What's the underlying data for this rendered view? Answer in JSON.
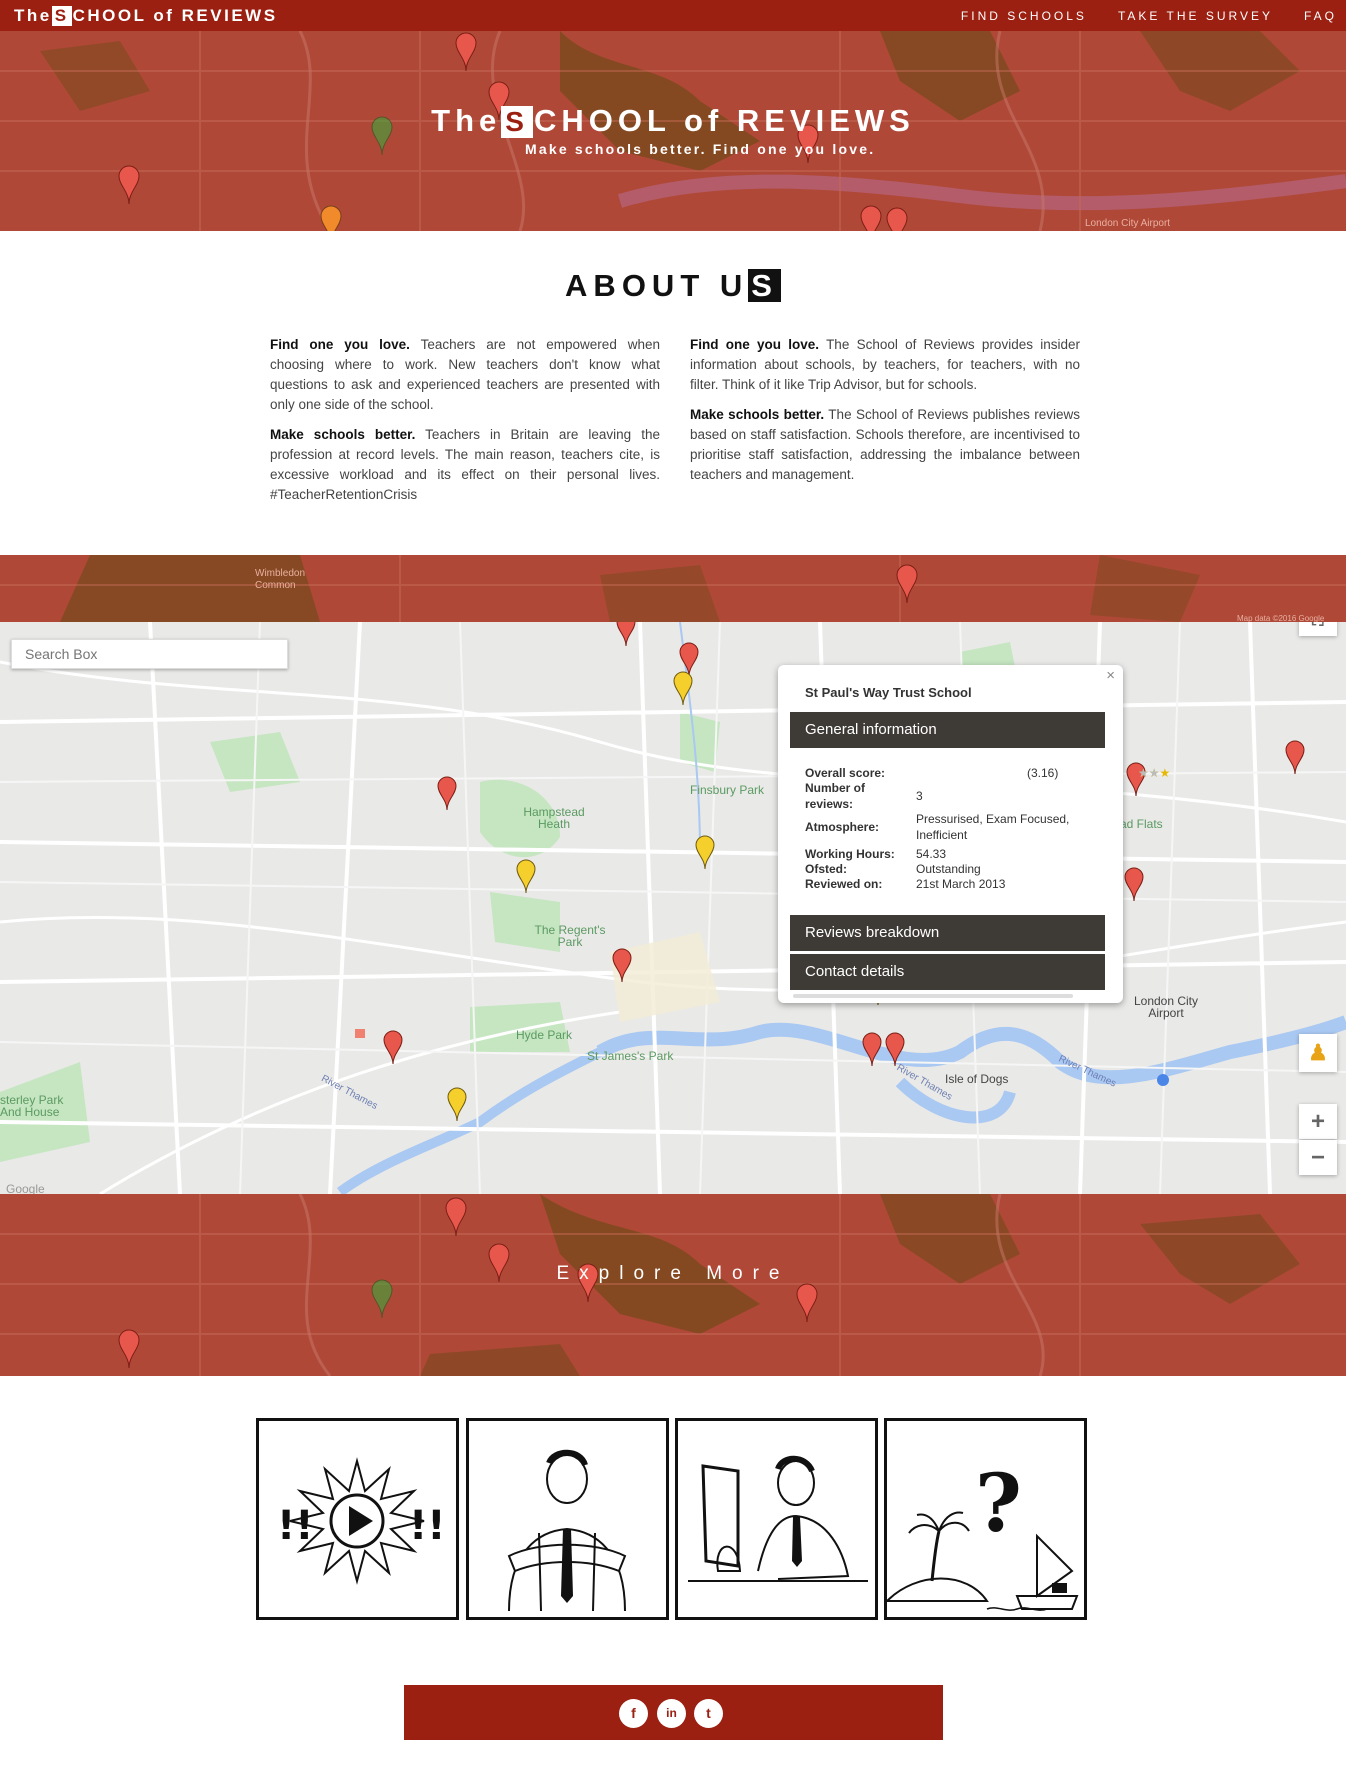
{
  "brand": {
    "prefix": "The",
    "letter": "S",
    "rest": "CHOOL of REVIEWS"
  },
  "nav": {
    "find_schools": "FIND SCHOOLS",
    "take_survey": "TAKE THE SURVEY",
    "faq": "FAQ"
  },
  "hero": {
    "title_prefix": "The",
    "title_letter": "S",
    "title_rest": "CHOOL of REVIEWS",
    "tagline": "Make schools better. Find one you love."
  },
  "about": {
    "title_main": "ABOUT U",
    "title_letter": "S",
    "left": [
      {
        "bold": "Find one you love.",
        "text": " Teachers are not empowered when choosing where to work. New teachers don't know what questions to ask and experienced teachers are presented with only one side of the school."
      },
      {
        "bold": "Make schools better.",
        "text": " Teachers in Britain are leaving the profession at record levels. The main reason, teachers cite, is excessive workload and its effect on their personal lives. #TeacherRetentionCrisis"
      }
    ],
    "right": [
      {
        "bold": "Find one you love.",
        "text": " The School of Reviews provides insider information about schools, by teachers, for teachers, with no filter. Think of it like Trip Advisor, but for schools."
      },
      {
        "bold": "Make schools better.",
        "text": " The School of Reviews publishes reviews based on staff satisfaction. Schools therefore, are incentivised to prioritise staff satisfaction, addressing the imbalance between teachers and management."
      }
    ]
  },
  "map": {
    "search_placeholder": "Search Box",
    "labels": {
      "finsbury": "Finsbury Park",
      "hampstead": "Hampstead Heath",
      "regents": "The Regent's Park",
      "hyde": "Hyde Park",
      "stjames": "St James's Park",
      "isle": "Isle of Dogs",
      "airport": "London City Airport",
      "osterley": "sterley Park And House",
      "flats": "ad Flats",
      "thames1": "River Thames",
      "thames2": "River Thames",
      "thames3": "River Thames",
      "google": "Google",
      "wimbledon": "Wimbledon Common",
      "airport_band": "London City Airport",
      "mapdata": "Map data ©2016 Google"
    },
    "zoom_in": "+",
    "zoom_out": "−",
    "popup": {
      "close": "×",
      "school": "St Paul's Way Trust School",
      "general_info": "General information",
      "overall_label": "Overall score:",
      "stars_on": "★★★",
      "stars_off": "★★",
      "overall_value": "(3.16)",
      "reviews_label": "Number of reviews:",
      "reviews_value": "3",
      "atmosphere_label": "Atmosphere:",
      "atmosphere_value": "Pressurised, Exam Focused, Inefficient",
      "hours_label": "Working Hours:",
      "hours_value": "54.33",
      "ofsted_label": "Ofsted:",
      "ofsted_value": "Outstanding",
      "reviewed_label": "Reviewed on:",
      "reviewed_value": "21st March 2013",
      "reviews_breakdown": "Reviews breakdown",
      "contact_details": "Contact details"
    }
  },
  "explore": "Explore More",
  "footer": {
    "facebook": "f",
    "linkedin": "in",
    "twitter": "t"
  },
  "colors": {
    "brand": "#9b2012",
    "map_overlay": "#b24a3a",
    "popup_header": "#3e3a36",
    "pin_red": "#e8574b",
    "pin_yellow": "#f5d02c",
    "pin_green": "#3aa83a",
    "pin_orange": "#f08a2a"
  }
}
